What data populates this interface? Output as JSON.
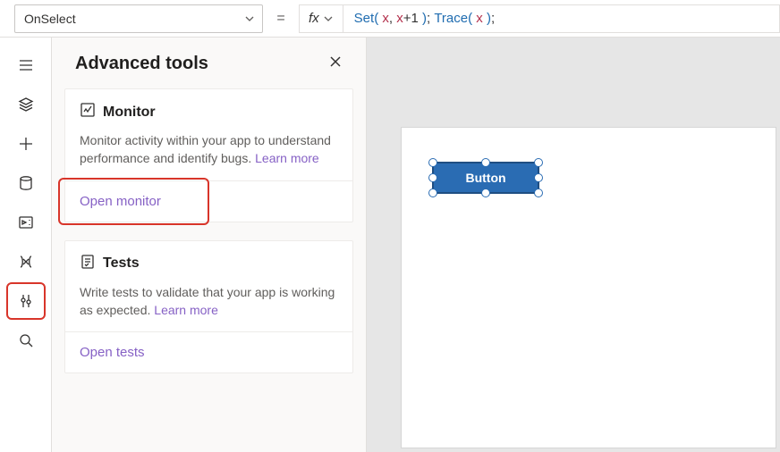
{
  "formulaBar": {
    "property": "OnSelect",
    "equals": "=",
    "fx_label": "fx",
    "formula_tokens": [
      {
        "cls": "tok-fn",
        "t": "Set"
      },
      {
        "cls": "tok-par",
        "t": "( "
      },
      {
        "cls": "tok-var",
        "t": "x"
      },
      {
        "cls": "tok-pun",
        "t": ", "
      },
      {
        "cls": "tok-var",
        "t": "x"
      },
      {
        "cls": "tok-pun",
        "t": "+"
      },
      {
        "cls": "tok-num",
        "t": "1"
      },
      {
        "cls": "tok-par",
        "t": " )"
      },
      {
        "cls": "tok-pun",
        "t": "; "
      },
      {
        "cls": "tok-fn",
        "t": "Trace"
      },
      {
        "cls": "tok-par",
        "t": "( "
      },
      {
        "cls": "tok-var",
        "t": "x"
      },
      {
        "cls": "tok-par",
        "t": " )"
      },
      {
        "cls": "tok-pun",
        "t": ";"
      }
    ]
  },
  "leftRail": {
    "items": [
      {
        "name": "hamburger-icon"
      },
      {
        "name": "layers-icon"
      },
      {
        "name": "plus-icon"
      },
      {
        "name": "database-icon"
      },
      {
        "name": "media-icon"
      },
      {
        "name": "variables-icon"
      },
      {
        "name": "tools-icon",
        "highlight": true
      },
      {
        "name": "search-icon"
      }
    ]
  },
  "panel": {
    "title": "Advanced tools",
    "cards": [
      {
        "icon": "monitor-icon",
        "title": "Monitor",
        "desc": "Monitor activity within your app to understand performance and identify bugs.",
        "learn_more": "Learn more",
        "action": "Open monitor",
        "action_highlight": true
      },
      {
        "icon": "tests-icon",
        "title": "Tests",
        "desc": "Write tests to validate that your app is working as expected.",
        "learn_more": "Learn more",
        "action": "Open tests",
        "action_highlight": false
      }
    ]
  },
  "canvas": {
    "button_label": "Button"
  }
}
